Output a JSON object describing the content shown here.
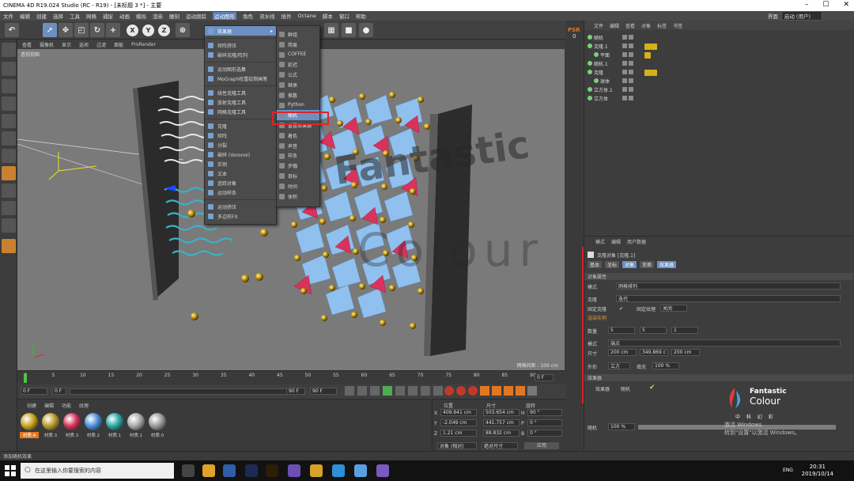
{
  "window": {
    "title": "CINEMA 4D R19.024 Studio (RC - R19) - [未标题 3 *] - 主要",
    "minimize": "–",
    "maximize": "☐",
    "close": "✕"
  },
  "menubar": {
    "items": [
      "文件",
      "编辑",
      "创建",
      "选择",
      "工具",
      "网格",
      "捕捉",
      "动画",
      "模拟",
      "渲染",
      "雕刻",
      "运动跟踪",
      "运动图形",
      "角色",
      "流水线",
      "插件",
      "Octane",
      "脚本",
      "窗口",
      "帮助"
    ],
    "active": "运动图形",
    "layout_label": "界面",
    "layout_value": "启动 (用户)"
  },
  "viewport_menu": [
    "查看",
    "摄像机",
    "显示",
    "选项",
    "过滤",
    "面板",
    "ProRender"
  ],
  "viewport": {
    "label": "透视视图",
    "grid_label": "网格间距 : 100 cm"
  },
  "menu_mograph": {
    "items": [
      {
        "label": "效果器",
        "highlight": true,
        "has_sub": true
      },
      {
        "label": "",
        "sep": true
      },
      {
        "label": "矩阵挤压"
      },
      {
        "label": "破碎克隆/阵列"
      },
      {
        "label": "",
        "sep": true
      },
      {
        "label": "运动图形选集"
      },
      {
        "label": "MoGraph权重绘制画笔"
      },
      {
        "label": "",
        "sep": true
      },
      {
        "label": "线性克隆工具"
      },
      {
        "label": "放射克隆工具"
      },
      {
        "label": "网格克隆工具"
      },
      {
        "label": "",
        "sep": true
      },
      {
        "label": "克隆"
      },
      {
        "label": "矩阵"
      },
      {
        "label": "分裂"
      },
      {
        "label": "破碎 (Voronoi)"
      },
      {
        "label": "实例"
      },
      {
        "label": "文本"
      },
      {
        "label": "追踪对象"
      },
      {
        "label": "运动样条"
      },
      {
        "label": "",
        "sep": true
      },
      {
        "label": "运动挤压"
      },
      {
        "label": "多边形FX"
      }
    ]
  },
  "menu_effectors": {
    "items": [
      "群组",
      "简易",
      "COFFEE",
      "延迟",
      "公式",
      "继承",
      "推散",
      "Python",
      "随机",
      "重置效果器",
      "着色",
      "声音",
      "样条",
      "步幅",
      "目标",
      "时间",
      "体积"
    ],
    "highlight": "随机"
  },
  "psr_label": "PSR",
  "psr_value": "0",
  "objmgr": {
    "tabs": [
      "文件",
      "编辑",
      "查看",
      "对象",
      "标签",
      "书签"
    ],
    "rows": [
      {
        "name": "随机"
      },
      {
        "name": "克隆.1"
      },
      {
        "name": "平面"
      },
      {
        "name": "随机.1"
      },
      {
        "name": "克隆"
      },
      {
        "name": "球体"
      },
      {
        "name": "立方体.1"
      },
      {
        "name": "立方体"
      }
    ]
  },
  "attrmgr": {
    "menu": [
      "模式",
      "编辑",
      "用户数据"
    ],
    "title": "克隆对象 [克隆.1]",
    "tabs": [
      "基本",
      "坐标",
      "对象",
      "变换",
      "效果器"
    ],
    "tabs_on": [
      "对象",
      "效果器"
    ],
    "section_object": "对象属性",
    "mode_label": "模式",
    "mode_value": "网格排列",
    "clones_label": "克隆",
    "clones_value": "迭代",
    "fix_clone_label": "固定克隆",
    "fix_texture_label": "固定纹理",
    "fix_texture_value": "关闭",
    "render_instances_label": "渲染实例",
    "count_label": "数量",
    "count": [
      "5",
      "5",
      "1"
    ],
    "mode2_label": "模式",
    "mode2_value": "端点",
    "size_label": "尺寸",
    "size": [
      "200 cm",
      "349.869 c",
      "200 cm"
    ],
    "shape_label": "外形",
    "shape_value": "立方",
    "fill_label": "填充",
    "fill_value": "100 %",
    "section_effectors": "效果器",
    "effectors_label": "效果器",
    "effector_item": "随机",
    "strength_label": "随机",
    "strength_value": "100 %"
  },
  "timeline": {
    "ticks": [
      "0",
      "5",
      "10",
      "15",
      "20",
      "25",
      "30",
      "35",
      "40",
      "45",
      "50",
      "55",
      "60",
      "65",
      "70",
      "75",
      "80",
      "85",
      "90"
    ],
    "end_field": "0 F"
  },
  "transport": {
    "start": "0 F",
    "min": "0 F",
    "max": "90 F",
    "end": "90 F"
  },
  "materials": {
    "menu": [
      "创建",
      "编辑",
      "功能",
      "纹理"
    ],
    "items": [
      {
        "label": "材质.4",
        "color": "#c9a21f"
      },
      {
        "label": "材质.3",
        "color": "#b89a2a"
      },
      {
        "label": "材质.3",
        "color": "#d2345a"
      },
      {
        "label": "材质.2",
        "color": "#4a8fd8"
      },
      {
        "label": "材质.1",
        "color": "#2aa7a3"
      },
      {
        "label": "材质.1",
        "color": "#a8a8a8"
      },
      {
        "label": "材质.0",
        "color": "#9a9a9a"
      }
    ]
  },
  "coords": {
    "headers": [
      "位置",
      "尺寸",
      "旋转"
    ],
    "rows": [
      {
        "axis": "X",
        "pos": "409.641 cm",
        "size": "503.654 cm",
        "rot_axis": "H",
        "rot": "90 °"
      },
      {
        "axis": "Y",
        "pos": "-2.049 cm",
        "size": "441.757 cm",
        "rot_axis": "P",
        "rot": "0 °"
      },
      {
        "axis": "Z",
        "pos": "1.21 cm",
        "size": "88.832 cm",
        "rot_axis": "B",
        "rot": "0 °"
      }
    ],
    "mode_value": "对象 (相对)",
    "size_mode_value": "绝对尺寸",
    "apply": "应用"
  },
  "status": {
    "text": "添加随机效果"
  },
  "watermark": {
    "line1": "Fantastic",
    "line2": "Colour",
    "cn": "中 科 幻 彩"
  },
  "logo": {
    "line1": "Fantastic",
    "line2": "Colour",
    "cn": "中 科 幻 彩"
  },
  "activate_windows": {
    "line1": "激活 Windows",
    "line2": "转到\"设置\"以激活 Windows。"
  },
  "taskbar": {
    "search_placeholder": "在这里输入你要搜索的内容",
    "time": "20:31",
    "date": "2019/10/14",
    "lang": "ENG"
  },
  "colors": {
    "accent": "#6d90c2",
    "highlight_box": "#e0232a"
  }
}
